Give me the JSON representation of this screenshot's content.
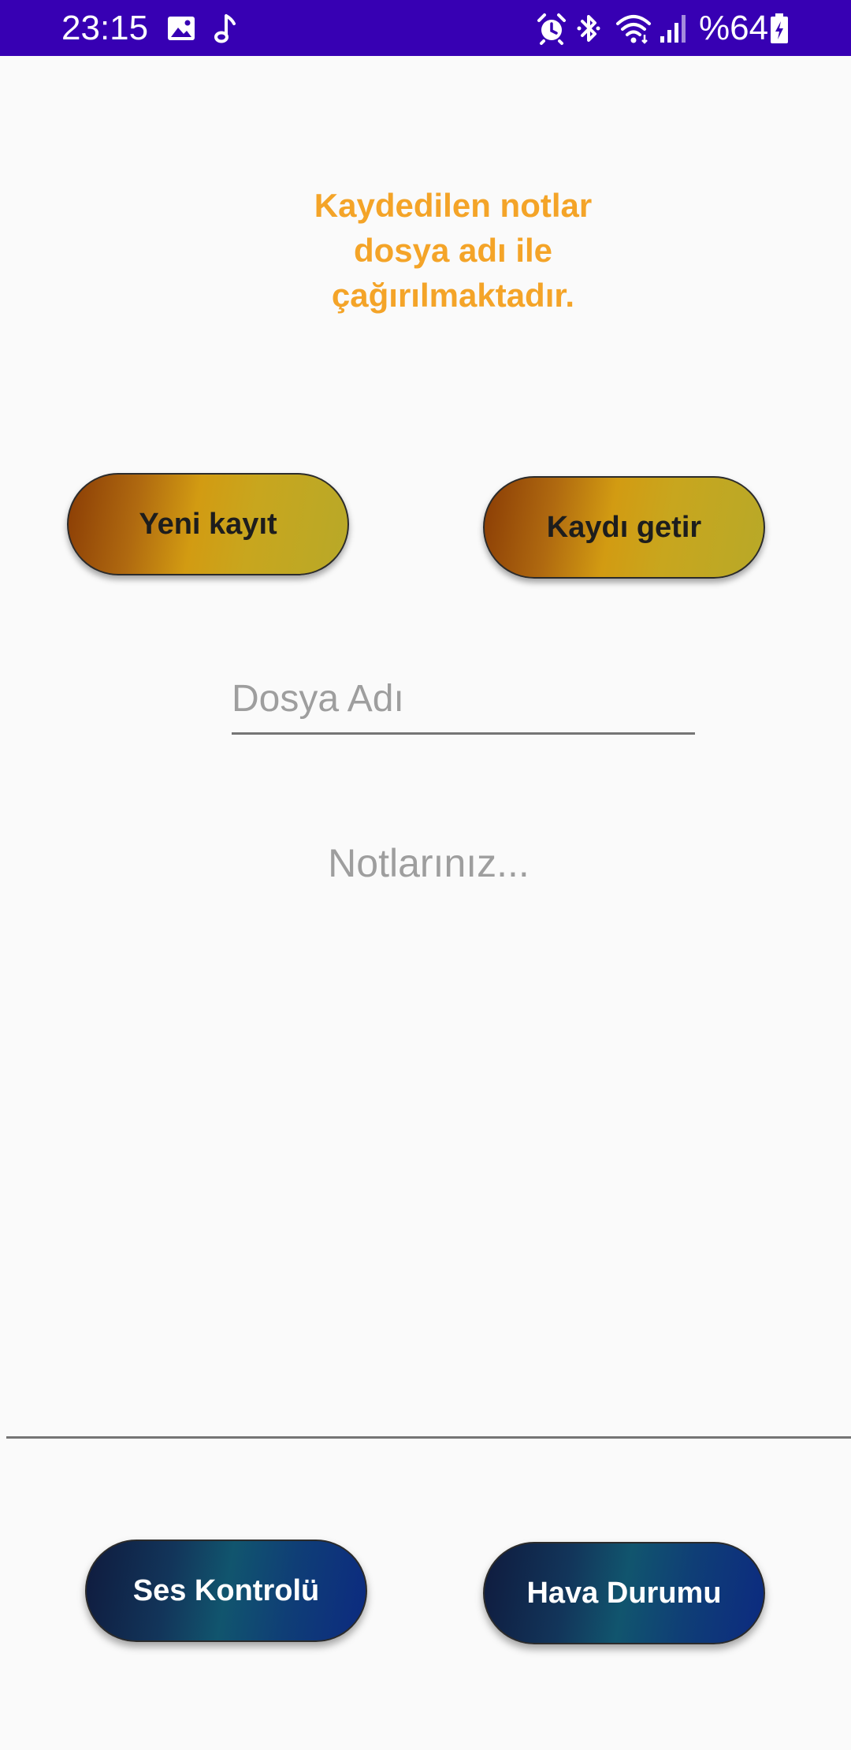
{
  "status_bar": {
    "time": "23:15",
    "battery_text": "%64",
    "left_icons": [
      "image-icon",
      "music-note-icon"
    ],
    "right_icons": [
      "alarm-icon",
      "bluetooth-icon",
      "wifi-icon",
      "signal-icon",
      "battery-charging-icon"
    ],
    "background_color": "#3700b3"
  },
  "main": {
    "heading": "Kaydedilen notlar\ndosya adı ile\nçağırılmaktadır.",
    "heading_color": "#f4a428",
    "new_record_button": "Yeni kayıt",
    "load_record_button": "Kaydı getir",
    "file_name_input": {
      "value": "",
      "placeholder": "Dosya Adı"
    },
    "notes_input": {
      "value": "",
      "placeholder": "Notlarınız..."
    },
    "sound_control_button": "Ses Kontrolü",
    "weather_button": "Hava Durumu"
  }
}
